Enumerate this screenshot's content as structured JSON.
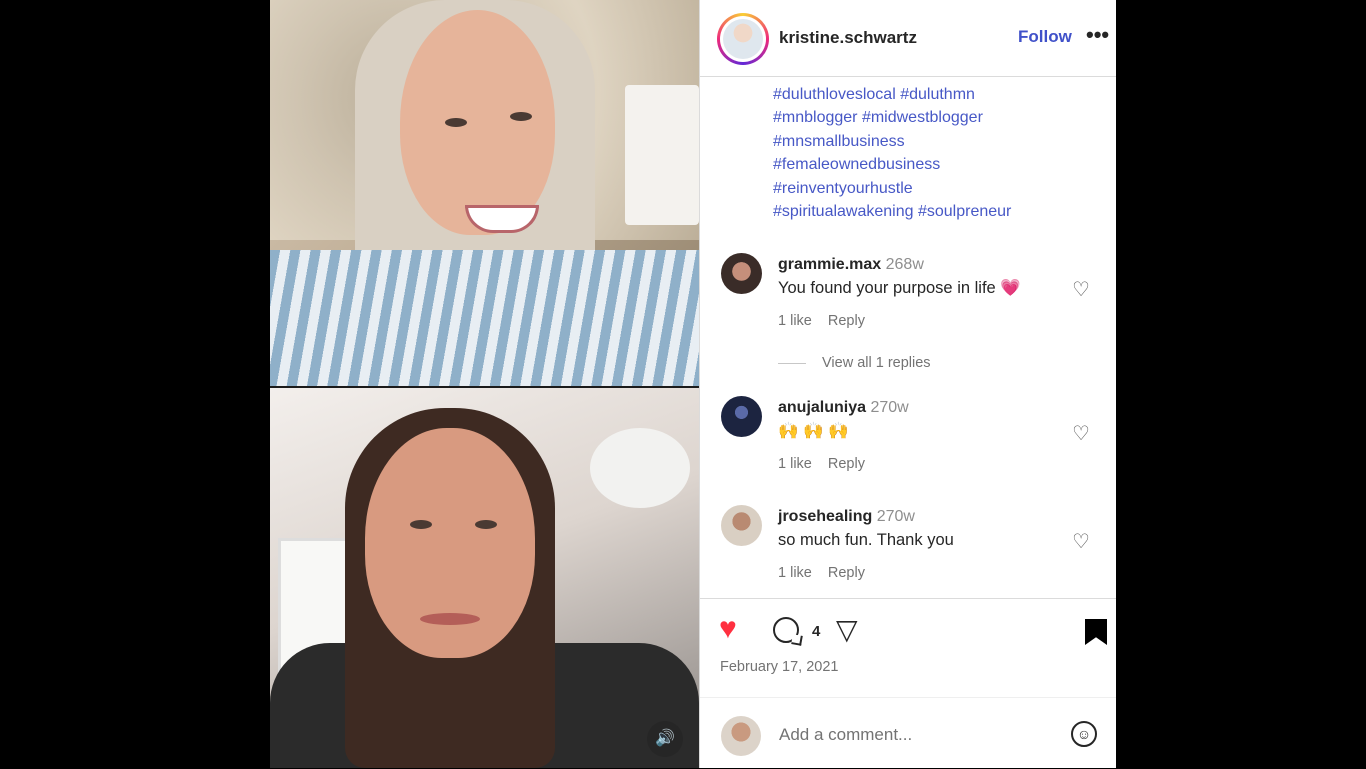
{
  "post": {
    "username": "kristine.schwartz",
    "follow_label": "Follow",
    "more_label": "•••",
    "sound_icon": "🔊",
    "hashtags": [
      "#duluthloveslocal #duluthmn",
      "#mnblogger #midwestblogger",
      "#mnsmallbusiness",
      "#femaleownedbusiness",
      "#reinventyourhustle",
      "#spiritualawakening #soulpreneur"
    ]
  },
  "comments": [
    {
      "username": "grammie.max",
      "time": "268w",
      "text": "You found your purpose in life 💗",
      "likes": "1 like",
      "reply": "Reply",
      "avatar_color": "#3a2c28"
    },
    {
      "username": "anujaluniya",
      "time": "270w",
      "text": "🙌 🙌 🙌",
      "likes": "1 like",
      "reply": "Reply",
      "avatar_color": "#1c2440"
    },
    {
      "username": "jrosehealing",
      "time": "270w",
      "text": "so much fun. Thank you",
      "likes": "1 like",
      "reply": "Reply",
      "avatar_color": "#c8b6a4"
    }
  ],
  "view_replies": "View all 1 replies",
  "actions": {
    "comment_count": "4",
    "date": "February 17, 2021",
    "like_icon": "♥",
    "share_icon": "▽",
    "heart_outline": "♡"
  },
  "add_comment": {
    "placeholder": "Add a comment...",
    "emoji_icon": "☺"
  }
}
